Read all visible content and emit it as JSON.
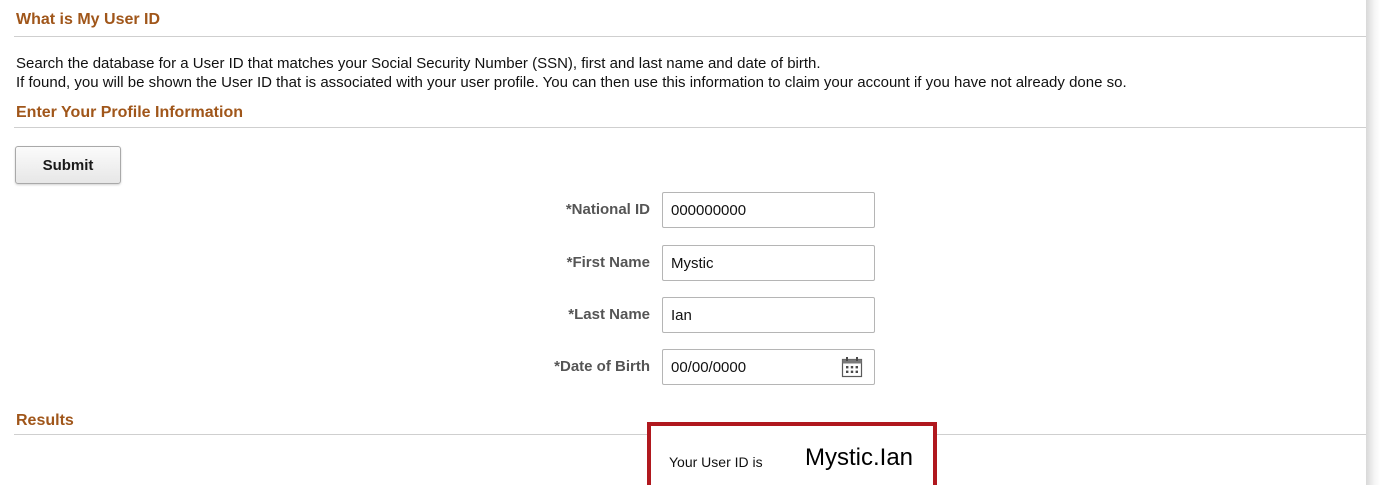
{
  "sections": {
    "user_id_title": "What is My User ID",
    "profile_title": "Enter Your Profile Information",
    "results_title": "Results"
  },
  "description": {
    "line1": "Search the database for a User ID that matches your Social Security Number (SSN), first and last name and date of birth.",
    "line2": "If found, you will be shown the User ID that is associated with your user profile. You can then use this information to claim your account if you have not already done so."
  },
  "buttons": {
    "submit_label": "Submit"
  },
  "fields": {
    "national_id": {
      "label": "*National ID",
      "value": "000000000"
    },
    "first_name": {
      "label": "*First Name",
      "value": "Mystic"
    },
    "last_name": {
      "label": "*Last Name",
      "value": "Ian"
    },
    "date_of_birth": {
      "label": "*Date of Birth",
      "value": "00/00/0000",
      "icon": "calendar-icon"
    }
  },
  "result": {
    "prefix": "Your User ID is",
    "user_id": "Mystic.Ian",
    "highlight_color": "#b0181e"
  },
  "colors": {
    "section_title": "#a0561a"
  }
}
